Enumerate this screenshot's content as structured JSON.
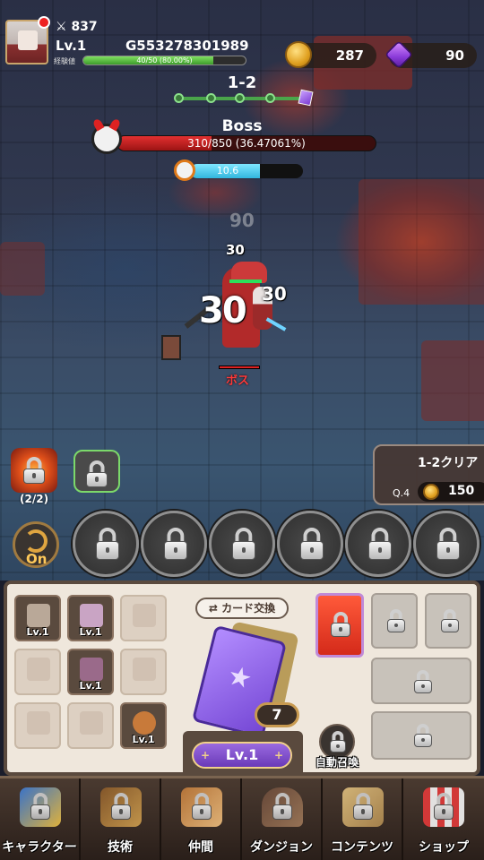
{
  "player": {
    "power": "837",
    "level": "Lv.1",
    "id": "G553278301989",
    "exp_label": "経験値",
    "exp_text": "40/50 (80.00%)",
    "exp_progress": 0.8
  },
  "currency": {
    "coins": "287",
    "gems": "90"
  },
  "stage": {
    "name": "1-2"
  },
  "boss": {
    "name": "Boss",
    "hp_text": "310/850 (36.47061%)",
    "hp_progress": 0.3647,
    "tag": "ボス"
  },
  "timer": {
    "value": "10.6",
    "progress": 0.62
  },
  "damage_numbers": [
    "90",
    "30",
    "30",
    "30"
  ],
  "skills": {
    "fire_count": "(2/2)"
  },
  "quest": {
    "title": "1-2クリア",
    "label": "Q.4",
    "reward": "150"
  },
  "auto_battle": {
    "label": "On"
  },
  "equipment": {
    "slots": [
      {
        "icon": "sword-icon",
        "level": "Lv.1"
      },
      {
        "icon": "armor-icon",
        "level": "Lv.1"
      },
      {
        "icon": "gloves-icon",
        "level": ""
      },
      {
        "icon": "pants-icon",
        "level": ""
      },
      {
        "icon": "boots-icon",
        "level": "Lv.1"
      },
      {
        "icon": "flame-icon",
        "level": ""
      },
      {
        "icon": "belt-icon",
        "level": ""
      },
      {
        "icon": "helmet-icon",
        "level": ""
      },
      {
        "icon": "shield-icon",
        "level": "Lv.1"
      }
    ]
  },
  "cards": {
    "swap_label": "カード交換",
    "count": "7",
    "level": "Lv.1",
    "auto_summon_label": "自動召喚"
  },
  "nav": {
    "items": [
      {
        "label": "キャラクター",
        "icon": "character-icon"
      },
      {
        "label": "技術",
        "icon": "skills-icon"
      },
      {
        "label": "仲間",
        "icon": "companions-icon"
      },
      {
        "label": "ダンジョン",
        "icon": "dungeon-icon"
      },
      {
        "label": "コンテンツ",
        "icon": "contents-icon"
      },
      {
        "label": "ショップ",
        "icon": "shop-icon"
      }
    ]
  },
  "colors": {
    "boss_hp": "#d42a2a",
    "exp": "#5cc043",
    "timer": "#4cc4ea",
    "panel": "#efe7dc",
    "accent_gold": "#e0a020",
    "card_purple": "#8a5ae0"
  }
}
